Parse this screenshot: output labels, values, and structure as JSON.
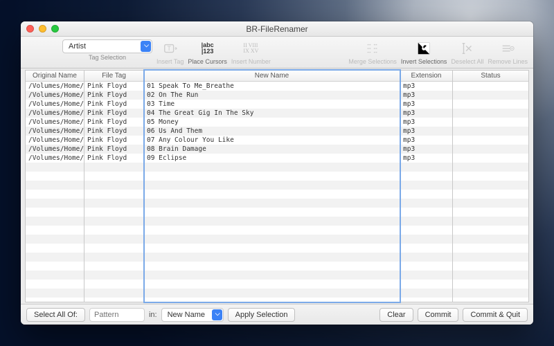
{
  "window": {
    "title": "BR-FileRenamer"
  },
  "toolbar": {
    "tag_select_value": "Artist",
    "tag_select_label": "Tag Selection",
    "insert_tag": "Insert Tag",
    "place_cursors": "Place Cursors",
    "insert_number": "Insert Number",
    "merge_selections": "Merge Selections",
    "invert_selections": "Invert Selections",
    "deselect_all": "Deselect All",
    "remove_lines": "Remove Lines"
  },
  "columns": {
    "original": "Original Name",
    "filetag": "File Tag",
    "newname": "New Name",
    "extension": "Extension",
    "status": "Status"
  },
  "rows": [
    {
      "original": "/Volumes/Home/",
      "filetag": "Pink Floyd",
      "newname": "01 Speak To Me_Breathe",
      "extension": "mp3",
      "status": ""
    },
    {
      "original": "/Volumes/Home/",
      "filetag": "Pink Floyd",
      "newname": "02 On The Run",
      "extension": "mp3",
      "status": ""
    },
    {
      "original": "/Volumes/Home/",
      "filetag": "Pink Floyd",
      "newname": "03 Time",
      "extension": "mp3",
      "status": ""
    },
    {
      "original": "/Volumes/Home/",
      "filetag": "Pink Floyd",
      "newname": "04 The Great Gig In The Sky",
      "extension": "mp3",
      "status": ""
    },
    {
      "original": "/Volumes/Home/",
      "filetag": "Pink Floyd",
      "newname": "05 Money",
      "extension": "mp3",
      "status": ""
    },
    {
      "original": "/Volumes/Home/",
      "filetag": "Pink Floyd",
      "newname": "06 Us And Them",
      "extension": "mp3",
      "status": ""
    },
    {
      "original": "/Volumes/Home/",
      "filetag": "Pink Floyd",
      "newname": "07 Any Colour You Like",
      "extension": "mp3",
      "status": ""
    },
    {
      "original": "/Volumes/Home/",
      "filetag": "Pink Floyd",
      "newname": "08 Brain Damage",
      "extension": "mp3",
      "status": ""
    },
    {
      "original": "/Volumes/Home/",
      "filetag": "Pink Floyd",
      "newname": "09 Eclipse",
      "extension": "mp3",
      "status": ""
    }
  ],
  "total_visible_rows": 27,
  "bottom": {
    "select_all_of": "Select All Of:",
    "pattern_placeholder": "Pattern",
    "in_label": "in:",
    "in_select_value": "New Name",
    "apply": "Apply Selection",
    "clear": "Clear",
    "commit": "Commit",
    "commit_quit": "Commit & Quit"
  }
}
